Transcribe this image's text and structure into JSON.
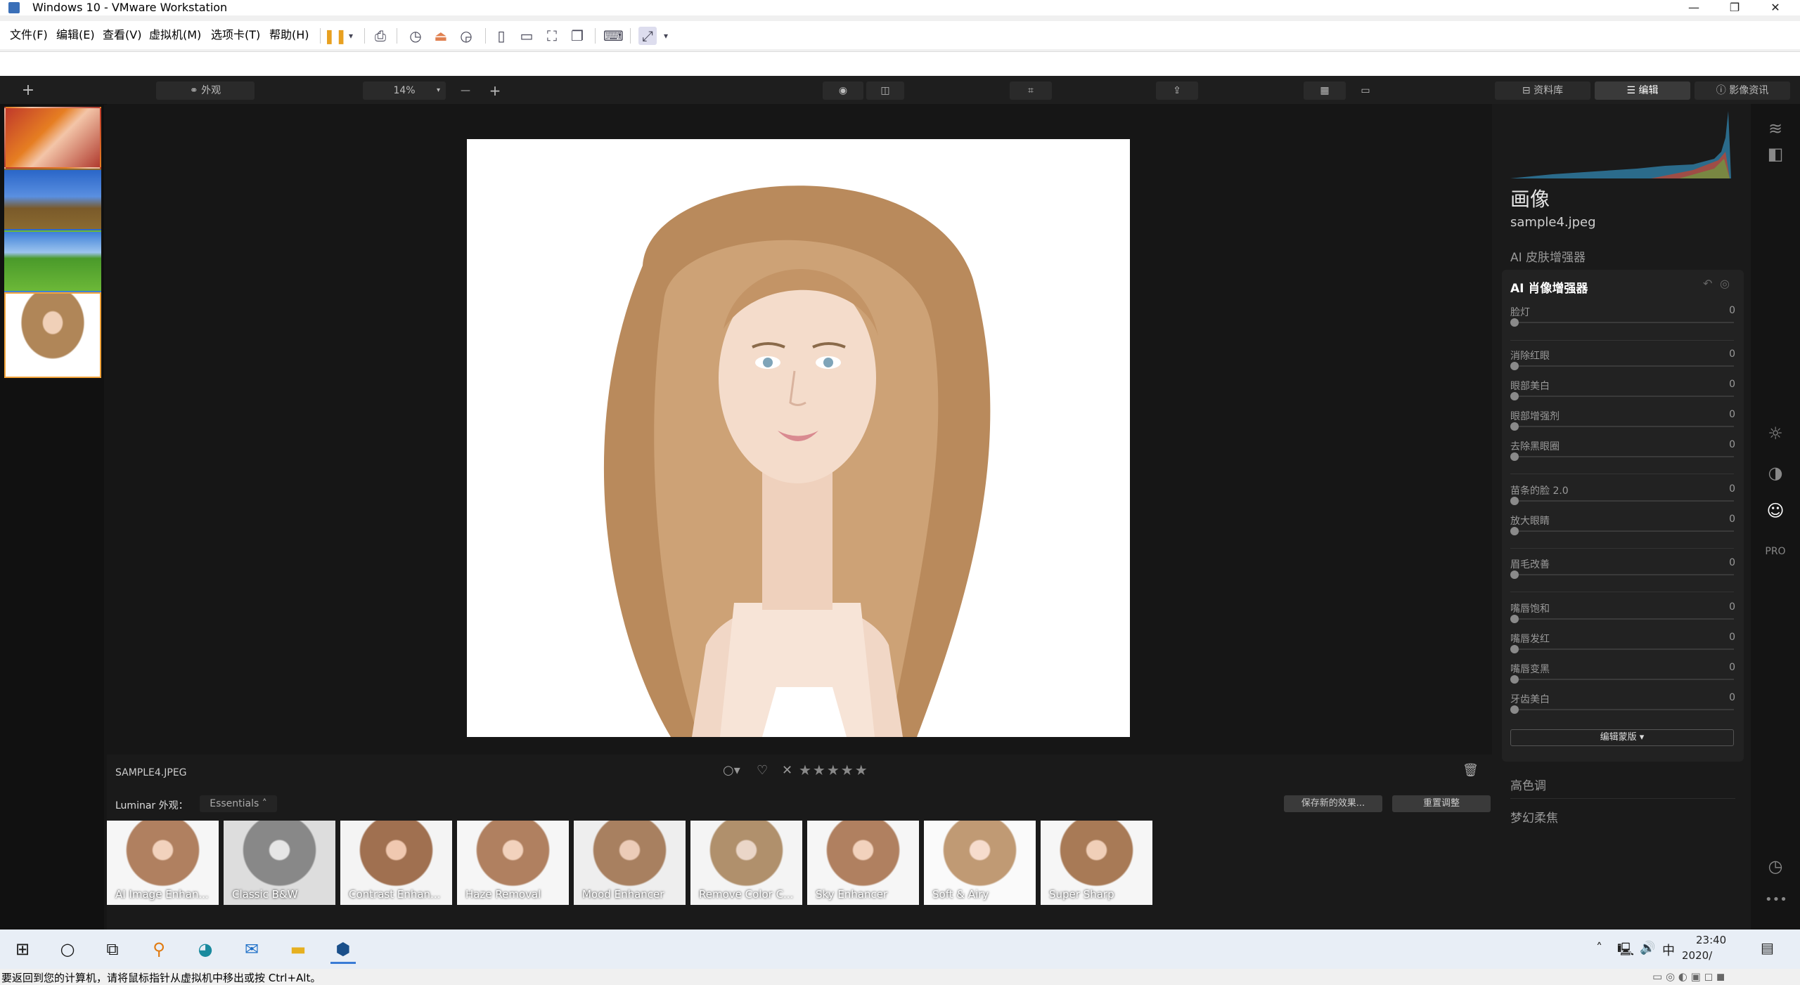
{
  "window": {
    "title": "Windows 10 - VMware Workstation",
    "controls": [
      "—",
      "❐",
      "✕"
    ]
  },
  "vm_menu": [
    "文件(F)",
    "编辑(E)",
    "查看(V)",
    "虚拟机(M)",
    "选项卡(T)",
    "帮助(H)"
  ],
  "toolbar": {
    "looks_label": "外观",
    "zoom_value": "14%",
    "tabs": [
      "资料库",
      "编辑",
      "影像资讯"
    ],
    "active_tab": "编辑"
  },
  "panel": {
    "title": "画像",
    "filename": "sample4.jpeg",
    "skin_tool": "AI 皮肤增强器",
    "portrait_tool": "AI 肖像增强器",
    "sliders": [
      {
        "name": "脸灯",
        "value": "0"
      },
      {
        "name": "消除红眼",
        "value": "0"
      },
      {
        "name": "眼部美白",
        "value": "0"
      },
      {
        "name": "眼部增强剂",
        "value": "0"
      },
      {
        "name": "去除黑眼圈",
        "value": "0"
      },
      {
        "name": "苗条的脸 2.0",
        "value": "0"
      },
      {
        "name": "放大眼睛",
        "value": "0"
      },
      {
        "name": "眉毛改善",
        "value": "0"
      },
      {
        "name": "嘴唇饱和",
        "value": "0"
      },
      {
        "name": "嘴唇发红",
        "value": "0"
      },
      {
        "name": "嘴唇变黑",
        "value": "0"
      },
      {
        "name": "牙齿美白",
        "value": "0"
      }
    ],
    "mask_button": "编辑蒙版 ▾",
    "high_key": "高色调",
    "dreamy": "梦幻柔焦"
  },
  "info": {
    "filename_upper": "SAMPLE4.JPEG",
    "looks_label": "Luminar 外观：",
    "looks_dropdown": "Essentials",
    "save_button": "保存新的效果...",
    "reset_button": "重置调整"
  },
  "looks": [
    "AI Image Enhan...",
    "Classic B&W",
    "Contrast Enhan...",
    "Haze Removal",
    "Mood Enhancer",
    "Remove Color C...",
    "Sky Enhancer",
    "Soft & Airy",
    "Super Sharp"
  ],
  "taskbar": {
    "time": "23:40",
    "date": "2020/",
    "ime": "中"
  },
  "status_text": "要返回到您的计算机，请将鼠标指针从虚拟机中移出或按 Ctrl+Alt。"
}
